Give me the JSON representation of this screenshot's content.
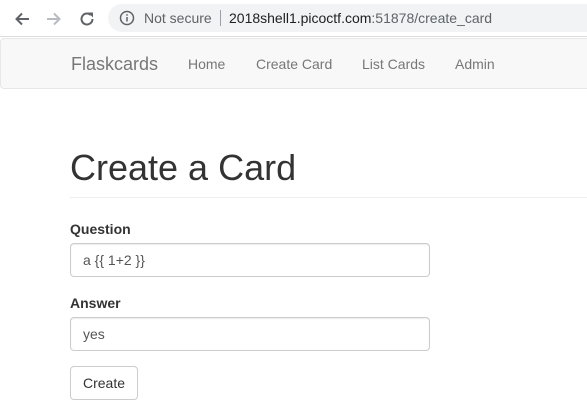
{
  "browser": {
    "security_label": "Not secure",
    "url_host": "2018shell1.picoctf.com",
    "url_rest": ":51878/create_card"
  },
  "navbar": {
    "brand": "Flaskcards",
    "links": [
      {
        "label": "Home"
      },
      {
        "label": "Create Card"
      },
      {
        "label": "List Cards"
      },
      {
        "label": "Admin"
      }
    ]
  },
  "main": {
    "title": "Create a Card",
    "question_label": "Question",
    "question_value": "a {{ 1+2 }}",
    "answer_label": "Answer",
    "answer_value": "yes",
    "submit_label": "Create"
  },
  "icons": {
    "back": "arrow-left-icon",
    "forward": "arrow-right-icon",
    "reload": "reload-icon",
    "info": "info-circle-icon"
  },
  "colors": {
    "navbar_bg": "#f8f8f8",
    "nav_text": "#777777",
    "title_text": "#333333"
  }
}
